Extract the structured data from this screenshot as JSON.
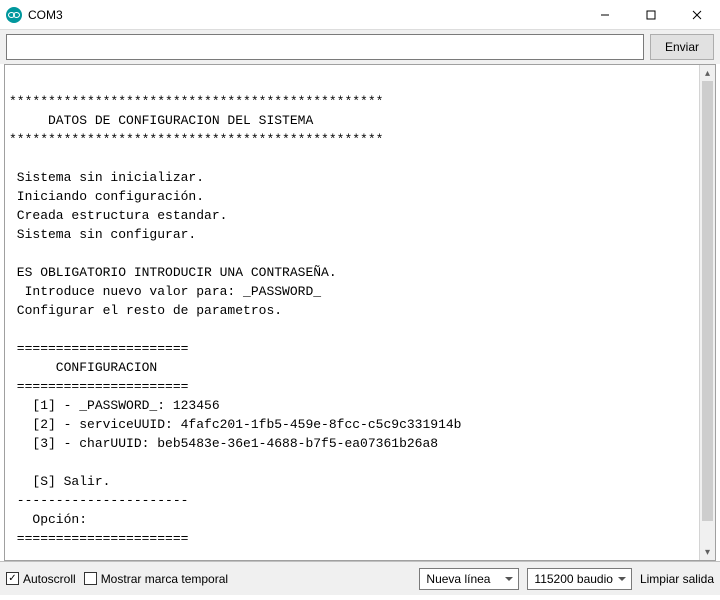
{
  "window": {
    "title": "COM3"
  },
  "input": {
    "value": "",
    "placeholder": ""
  },
  "buttons": {
    "send": "Enviar",
    "clear": "Limpiar salida"
  },
  "footer": {
    "autoscroll_label": "Autoscroll",
    "autoscroll_checked": true,
    "timestamp_label": "Mostrar marca temporal",
    "timestamp_checked": false,
    "line_ending_selected": "Nueva línea",
    "baud_selected": "115200 baudio"
  },
  "console_lines": [
    "",
    "************************************************",
    "     DATOS DE CONFIGURACION DEL SISTEMA",
    "************************************************",
    "",
    " Sistema sin inicializar.",
    " Iniciando configuración.",
    " Creada estructura estandar.",
    " Sistema sin configurar.",
    "",
    " ES OBLIGATORIO INTRODUCIR UNA CONTRASEÑA.",
    "  Introduce nuevo valor para: _PASSWORD_",
    " Configurar el resto de parametros.",
    "",
    " ======================",
    "      CONFIGURACION",
    " ======================",
    "   [1] - _PASSWORD_: 123456",
    "   [2] - serviceUUID: 4fafc201-1fb5-459e-8fcc-c5c9c331914b",
    "   [3] - charUUID: beb5483e-36e1-4688-b7f5-ea07361b26a8",
    "",
    "   [S] Salir.",
    " ----------------------",
    "   Opción:",
    " ======================"
  ]
}
